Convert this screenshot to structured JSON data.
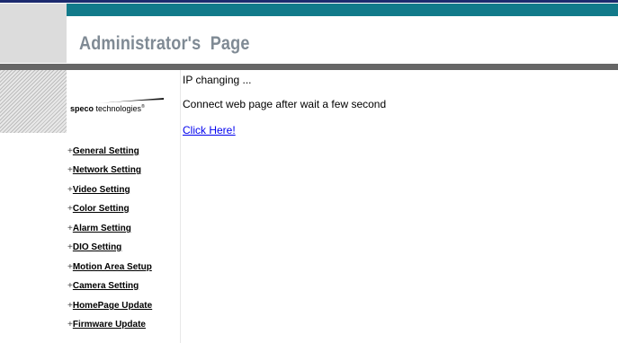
{
  "header": {
    "title": "Administrator's  Page"
  },
  "logo": {
    "brand_bold": "speco",
    "brand_rest": " technologies",
    "registered": "®"
  },
  "sidebar": {
    "items": [
      {
        "plus": "+",
        "label": "General Setting"
      },
      {
        "plus": "+",
        "label": "Network Setting"
      },
      {
        "plus": "+",
        "label": "Video Setting"
      },
      {
        "plus": "+",
        "label": "Color Setting"
      },
      {
        "plus": "+",
        "label": "Alarm Setting"
      },
      {
        "plus": "+",
        "label": "DIO Setting"
      },
      {
        "plus": "+",
        "label": "Motion Area Setup"
      },
      {
        "plus": "+",
        "label": "Camera Setting"
      },
      {
        "plus": "+",
        "label": "HomePage Update"
      },
      {
        "plus": "+",
        "label": "Firmware Update"
      }
    ]
  },
  "main": {
    "status": "IP changing ...",
    "instruction": "Connect web page after wait a few second",
    "link_label": "Click Here!"
  },
  "colors": {
    "navy": "#1c2a6e",
    "teal": "#127a8a",
    "bar_gray": "#666666",
    "title_gray": "#7f8a94",
    "link_blue": "#0000ee"
  }
}
